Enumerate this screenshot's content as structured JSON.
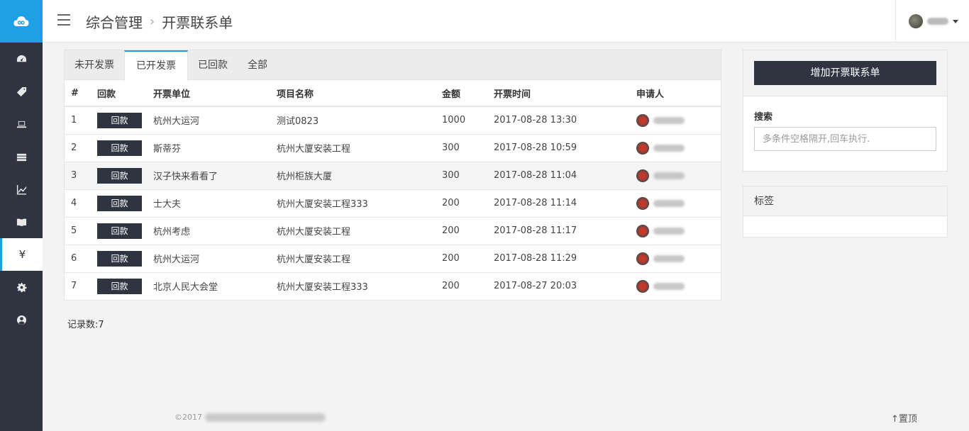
{
  "breadcrumb": {
    "parent": "综合管理",
    "current": "开票联系单"
  },
  "sidebar": {
    "items": [
      {
        "icon": "dashboard-icon",
        "active": false
      },
      {
        "icon": "tag-icon",
        "active": false
      },
      {
        "icon": "laptop-icon",
        "active": false
      },
      {
        "icon": "server-icon",
        "active": false
      },
      {
        "icon": "line-chart-icon",
        "active": false
      },
      {
        "icon": "book-icon",
        "active": false
      },
      {
        "icon": "yen-icon",
        "active": true,
        "glyph": "¥"
      },
      {
        "icon": "gear-icon",
        "active": false
      },
      {
        "icon": "user-circle-icon",
        "active": false
      }
    ]
  },
  "tabs": [
    "未开发票",
    "已开发票",
    "已回款",
    "全部"
  ],
  "active_tab": 1,
  "table": {
    "headers": [
      "#",
      "回款",
      "开票单位",
      "项目名称",
      "金额",
      "开票时间",
      "申请人"
    ],
    "button_label": "回款",
    "rows": [
      {
        "num": "1",
        "unit": "杭州大运河",
        "project": "测试0823",
        "amount": "1000",
        "time": "2017-08-28 13:30"
      },
      {
        "num": "2",
        "unit": "斯蒂芬",
        "project": "杭州大厦安装工程",
        "amount": "300",
        "time": "2017-08-28 10:59"
      },
      {
        "num": "3",
        "unit": "汉子快来看看了",
        "project": "杭州柜族大厦",
        "amount": "300",
        "time": "2017-08-28 11:04"
      },
      {
        "num": "4",
        "unit": "士大夫",
        "project": "杭州大厦安装工程333",
        "amount": "200",
        "time": "2017-08-28 11:14"
      },
      {
        "num": "5",
        "unit": "杭州考虑",
        "project": "杭州大厦安装工程",
        "amount": "200",
        "time": "2017-08-28 11:17"
      },
      {
        "num": "6",
        "unit": "杭州大运河",
        "project": "杭州大厦安装工程",
        "amount": "200",
        "time": "2017-08-28 11:29"
      },
      {
        "num": "7",
        "unit": "北京人民大会堂",
        "project": "杭州大厦安装工程333",
        "amount": "200",
        "time": "2017-08-27 20:03"
      }
    ]
  },
  "record_count": "记录数:7",
  "right_panel": {
    "add_button": "增加开票联系单",
    "search_label": "搜索",
    "search_placeholder": "多条件空格隔开,回车执行.",
    "tags_title": "标签"
  },
  "footer": {
    "copyright": "©2017",
    "top_link": "↑置顶"
  },
  "colors": {
    "sidebar": "#2f3441",
    "logo": "#1f9fe4",
    "accent": "#1f9fe4"
  }
}
